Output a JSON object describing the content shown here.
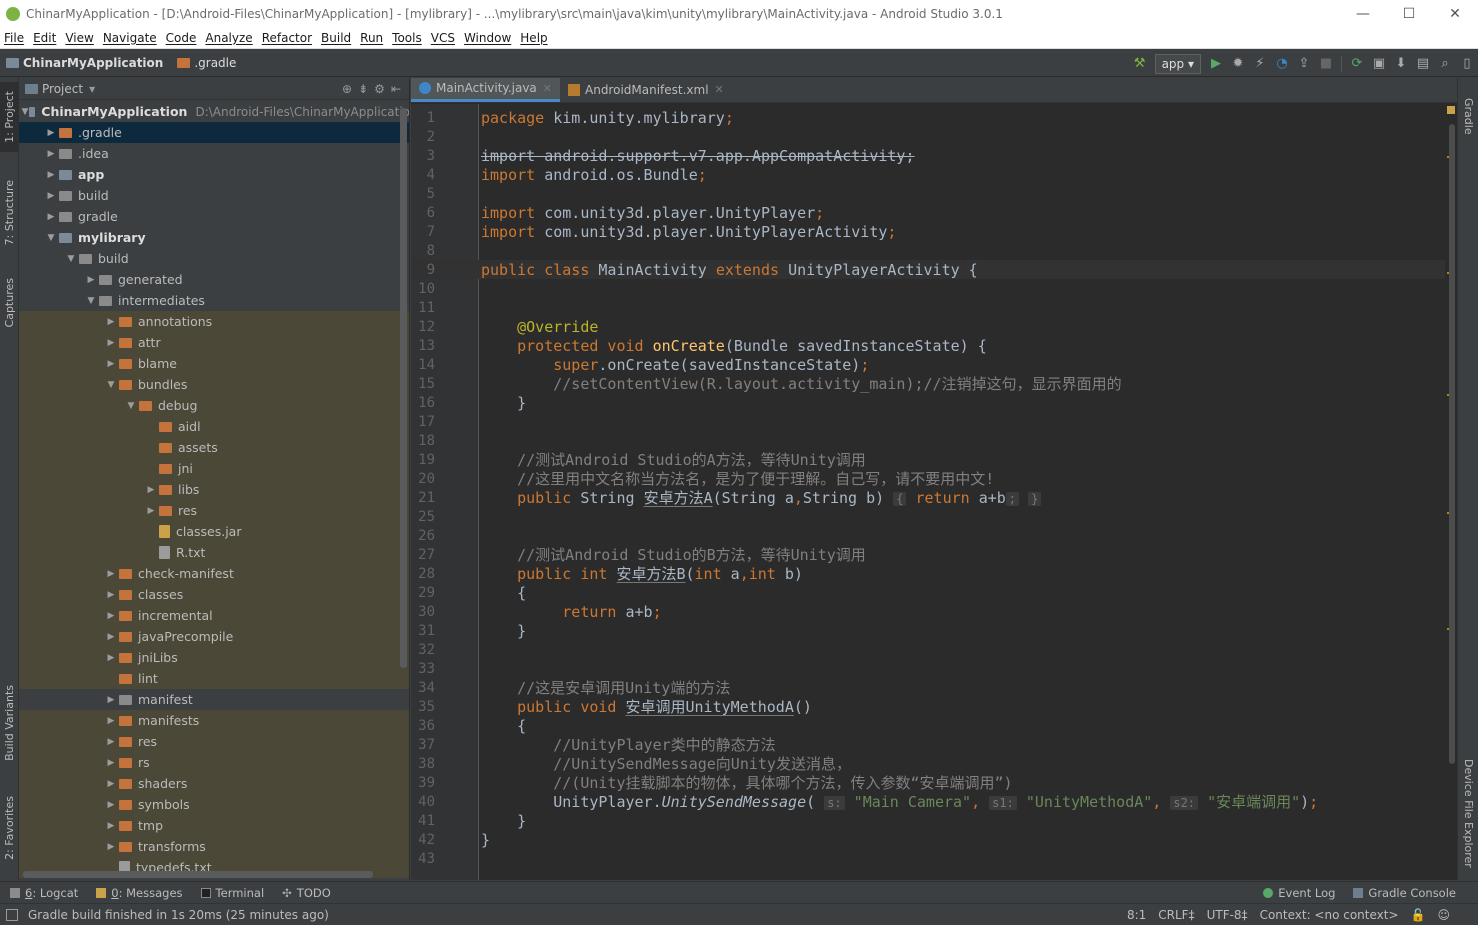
{
  "window": {
    "title": "ChinarMyApplication - [D:\\Android-Files\\ChinarMyApplication] - [mylibrary] - ...\\mylibrary\\src\\main\\java\\kim\\unity\\mylibrary\\MainActivity.java - Android Studio 3.0.1",
    "minimize": "—",
    "maximize": "☐",
    "close": "✕"
  },
  "menu": [
    "File",
    "Edit",
    "View",
    "Navigate",
    "Code",
    "Analyze",
    "Refactor",
    "Build",
    "Run",
    "Tools",
    "VCS",
    "Window",
    "Help"
  ],
  "nav": {
    "project": "ChinarMyApplication",
    "folder": ".gradle",
    "run_config": "app"
  },
  "left_tabs": [
    "1: Project",
    "7: Structure",
    "Captures",
    "Build Variants",
    "2: Favorites"
  ],
  "right_tabs": [
    "Gradle",
    "Device File Explorer"
  ],
  "project_panel": {
    "title": "Project",
    "root_path": "D:\\Android-Files\\ChinarMyApplicatio"
  },
  "tree": [
    {
      "label": "ChinarMyApplication",
      "depth": 0,
      "arrow": "▼",
      "icon": "mod",
      "bold": true,
      "path": true
    },
    {
      "label": ".gradle",
      "depth": 1,
      "arrow": "▶",
      "icon": "or",
      "sel": true
    },
    {
      "label": ".idea",
      "depth": 1,
      "arrow": "▶",
      "icon": "plain"
    },
    {
      "label": "app",
      "depth": 1,
      "arrow": "▶",
      "icon": "mod",
      "bold": true
    },
    {
      "label": "build",
      "depth": 1,
      "arrow": "▶",
      "icon": "plain"
    },
    {
      "label": "gradle",
      "depth": 1,
      "arrow": "▶",
      "icon": "plain"
    },
    {
      "label": "mylibrary",
      "depth": 1,
      "arrow": "▼",
      "icon": "mod",
      "bold": true
    },
    {
      "label": "build",
      "depth": 2,
      "arrow": "▼",
      "icon": "plain"
    },
    {
      "label": "generated",
      "depth": 3,
      "arrow": "▶",
      "icon": "plain"
    },
    {
      "label": "intermediates",
      "depth": 3,
      "arrow": "▼",
      "icon": "plain"
    },
    {
      "label": "annotations",
      "depth": 4,
      "arrow": "▶",
      "icon": "or",
      "tint": true
    },
    {
      "label": "attr",
      "depth": 4,
      "arrow": "▶",
      "icon": "or",
      "tint": true
    },
    {
      "label": "blame",
      "depth": 4,
      "arrow": "▶",
      "icon": "or",
      "tint": true
    },
    {
      "label": "bundles",
      "depth": 4,
      "arrow": "▼",
      "icon": "or",
      "tint": true
    },
    {
      "label": "debug",
      "depth": 5,
      "arrow": "▼",
      "icon": "or",
      "tint": true
    },
    {
      "label": "aidl",
      "depth": 6,
      "arrow": "",
      "icon": "or",
      "tint": true
    },
    {
      "label": "assets",
      "depth": 6,
      "arrow": "",
      "icon": "or",
      "tint": true
    },
    {
      "label": "jni",
      "depth": 6,
      "arrow": "",
      "icon": "or",
      "tint": true
    },
    {
      "label": "libs",
      "depth": 6,
      "arrow": "▶",
      "icon": "or",
      "tint": true
    },
    {
      "label": "res",
      "depth": 6,
      "arrow": "▶",
      "icon": "or",
      "tint": true
    },
    {
      "label": "classes.jar",
      "depth": 6,
      "arrow": "",
      "icon": "jar",
      "tint": true
    },
    {
      "label": "R.txt",
      "depth": 6,
      "arrow": "",
      "icon": "file",
      "tint": true
    },
    {
      "label": "check-manifest",
      "depth": 4,
      "arrow": "▶",
      "icon": "or",
      "tint": true
    },
    {
      "label": "classes",
      "depth": 4,
      "arrow": "▶",
      "icon": "or",
      "tint": true
    },
    {
      "label": "incremental",
      "depth": 4,
      "arrow": "▶",
      "icon": "or",
      "tint": true
    },
    {
      "label": "javaPrecompile",
      "depth": 4,
      "arrow": "▶",
      "icon": "or",
      "tint": true
    },
    {
      "label": "jniLibs",
      "depth": 4,
      "arrow": "▶",
      "icon": "or",
      "tint": true
    },
    {
      "label": "lint",
      "depth": 4,
      "arrow": "",
      "icon": "or",
      "tint": true
    },
    {
      "label": "manifest",
      "depth": 4,
      "arrow": "▶",
      "icon": "plain",
      "tint": false
    },
    {
      "label": "manifests",
      "depth": 4,
      "arrow": "▶",
      "icon": "or",
      "tint": true
    },
    {
      "label": "res",
      "depth": 4,
      "arrow": "▶",
      "icon": "or",
      "tint": true
    },
    {
      "label": "rs",
      "depth": 4,
      "arrow": "▶",
      "icon": "or",
      "tint": true
    },
    {
      "label": "shaders",
      "depth": 4,
      "arrow": "▶",
      "icon": "or",
      "tint": true
    },
    {
      "label": "symbols",
      "depth": 4,
      "arrow": "▶",
      "icon": "or",
      "tint": true
    },
    {
      "label": "tmp",
      "depth": 4,
      "arrow": "▶",
      "icon": "or",
      "tint": true
    },
    {
      "label": "transforms",
      "depth": 4,
      "arrow": "▶",
      "icon": "or",
      "tint": true
    },
    {
      "label": "typedefs.txt",
      "depth": 4,
      "arrow": "",
      "icon": "file",
      "tint": true
    }
  ],
  "tabs": [
    {
      "label": "MainActivity.java",
      "active": true
    },
    {
      "label": "AndroidManifest.xml",
      "active": false
    }
  ],
  "code": [
    {
      "n": "1",
      "t": [
        [
          "kw",
          "package "
        ],
        [
          "",
          "kim.unity.mylibrary"
        ],
        [
          "kw",
          ";"
        ]
      ]
    },
    {
      "n": "2",
      "t": []
    },
    {
      "n": "3",
      "t": [
        [
          "strike",
          "import android.support.v7.app.AppCompatActivity;"
        ]
      ]
    },
    {
      "n": "4",
      "t": [
        [
          "kw",
          "import "
        ],
        [
          "",
          "android.os.Bundle"
        ],
        [
          "kw",
          ";"
        ]
      ]
    },
    {
      "n": "5",
      "t": []
    },
    {
      "n": "6",
      "t": [
        [
          "kw",
          "import "
        ],
        [
          "",
          "com.unity3d.player.UnityPlayer"
        ],
        [
          "kw",
          ";"
        ]
      ]
    },
    {
      "n": "7",
      "t": [
        [
          "kw",
          "import "
        ],
        [
          "",
          "com.unity3d.player.UnityPlayerActivity"
        ],
        [
          "kw",
          ";"
        ]
      ]
    },
    {
      "n": "8",
      "t": []
    },
    {
      "n": "9",
      "t": [
        [
          "kw",
          "public class "
        ],
        [
          "",
          "MainActivity "
        ],
        [
          "kw",
          "extends "
        ],
        [
          "",
          "UnityPlayerActivity {"
        ]
      ],
      "cur": true
    },
    {
      "n": "10",
      "t": []
    },
    {
      "n": "11",
      "t": []
    },
    {
      "n": "12",
      "t": [
        [
          "",
          "    "
        ],
        [
          "an",
          "@Override"
        ]
      ]
    },
    {
      "n": "13",
      "t": [
        [
          "",
          "    "
        ],
        [
          "kw",
          "protected void "
        ],
        [
          "fn",
          "onCreate"
        ],
        [
          "",
          "(Bundle savedInstanceState) {"
        ]
      ]
    },
    {
      "n": "14",
      "t": [
        [
          "",
          "        "
        ],
        [
          "kw",
          "super"
        ],
        [
          "",
          ".onCreate(savedInstanceState)"
        ],
        [
          "kw",
          ";"
        ]
      ]
    },
    {
      "n": "15",
      "t": [
        [
          "",
          "        "
        ],
        [
          "cm",
          "//setContentView(R.layout.activity_main);//注销掉这句，显示界面用的"
        ]
      ]
    },
    {
      "n": "16",
      "t": [
        [
          "",
          "    }"
        ]
      ]
    },
    {
      "n": "17",
      "t": []
    },
    {
      "n": "18",
      "t": []
    },
    {
      "n": "19",
      "t": [
        [
          "",
          "    "
        ],
        [
          "cm",
          "//测试Android Studio的A方法，等待Unity调用"
        ]
      ]
    },
    {
      "n": "20",
      "t": [
        [
          "",
          "    "
        ],
        [
          "cm",
          "//这里用中文名称当方法名，是为了便于理解。自己写，请不要用中文!"
        ]
      ]
    },
    {
      "n": "21",
      "t": [
        [
          "",
          "    "
        ],
        [
          "kw",
          "public "
        ],
        [
          "",
          "String "
        ],
        [
          "ul",
          "安卓方法A"
        ],
        [
          "",
          "(String a"
        ],
        [
          "kw",
          ","
        ],
        [
          "",
          "String b) "
        ],
        [
          "hint",
          "{"
        ],
        [
          "kw",
          " return "
        ],
        [
          "",
          "a+b"
        ],
        [
          "hint",
          ";"
        ],
        [
          "",
          " "
        ],
        [
          "hint",
          "}"
        ]
      ]
    },
    {
      "n": "25",
      "t": []
    },
    {
      "n": "26",
      "t": []
    },
    {
      "n": "27",
      "t": [
        [
          "",
          "    "
        ],
        [
          "cm",
          "//测试Android Studio的B方法，等待Unity调用"
        ]
      ]
    },
    {
      "n": "28",
      "t": [
        [
          "",
          "    "
        ],
        [
          "kw",
          "public int "
        ],
        [
          "ul",
          "安卓方法B"
        ],
        [
          "",
          "("
        ],
        [
          "kw",
          "int "
        ],
        [
          "",
          "a"
        ],
        [
          "kw",
          ","
        ],
        [
          "kw",
          "int "
        ],
        [
          "",
          "b)"
        ]
      ]
    },
    {
      "n": "29",
      "t": [
        [
          "",
          "    {"
        ]
      ]
    },
    {
      "n": "30",
      "t": [
        [
          "",
          "         "
        ],
        [
          "kw",
          "return "
        ],
        [
          "",
          "a+b"
        ],
        [
          "kw",
          ";"
        ]
      ]
    },
    {
      "n": "31",
      "t": [
        [
          "",
          "    }"
        ]
      ]
    },
    {
      "n": "32",
      "t": []
    },
    {
      "n": "33",
      "t": []
    },
    {
      "n": "34",
      "t": [
        [
          "",
          "    "
        ],
        [
          "cm",
          "//这是安卓调用Unity端的方法"
        ]
      ]
    },
    {
      "n": "35",
      "t": [
        [
          "",
          "    "
        ],
        [
          "kw",
          "public void "
        ],
        [
          "ul",
          "安卓调用UnityMethodA"
        ],
        [
          "",
          "()"
        ]
      ]
    },
    {
      "n": "36",
      "t": [
        [
          "",
          "    {"
        ]
      ]
    },
    {
      "n": "37",
      "t": [
        [
          "",
          "        "
        ],
        [
          "cm",
          "//UnityPlayer类中的静态方法"
        ]
      ]
    },
    {
      "n": "38",
      "t": [
        [
          "",
          "        "
        ],
        [
          "cm",
          "//UnitySendMessage向Unity发送消息，"
        ]
      ]
    },
    {
      "n": "39",
      "t": [
        [
          "",
          "        "
        ],
        [
          "cm",
          "//(Unity挂载脚本的物体，具体哪个方法，传入参数“安卓端调用”)"
        ]
      ]
    },
    {
      "n": "40",
      "t": [
        [
          "",
          "        UnityPlayer."
        ],
        [
          "it",
          "UnitySendMessage"
        ],
        [
          "",
          "( "
        ],
        [
          "hint",
          "s:"
        ],
        [
          "st",
          " \"Main Camera\""
        ],
        [
          "kw",
          ", "
        ],
        [
          "hint",
          "s1:"
        ],
        [
          "st",
          " \"UnityMethodA\""
        ],
        [
          "kw",
          ", "
        ],
        [
          "hint",
          "s2:"
        ],
        [
          "st",
          " \"安卓端调用\""
        ],
        [
          "",
          ")"
        ],
        [
          "kw",
          ";"
        ]
      ]
    },
    {
      "n": "41",
      "t": [
        [
          "",
          "    }"
        ]
      ]
    },
    {
      "n": "42",
      "t": [
        [
          "",
          "}"
        ]
      ]
    },
    {
      "n": "43",
      "t": []
    }
  ],
  "bottom_tools": {
    "left": [
      {
        "key": "6",
        "label": ": Logcat"
      },
      {
        "key": "0",
        "label": ": Messages"
      },
      {
        "key": "",
        "label": "Terminal"
      },
      {
        "key": "",
        "label": "TODO"
      }
    ],
    "right": [
      "Event Log",
      "Gradle Console"
    ]
  },
  "status": {
    "message": "Gradle build finished in 1s 20ms (25 minutes ago)",
    "position": "8:1",
    "line_sep": "CRLF‡",
    "encoding": "UTF-8‡",
    "context": "Context: <no context>"
  }
}
